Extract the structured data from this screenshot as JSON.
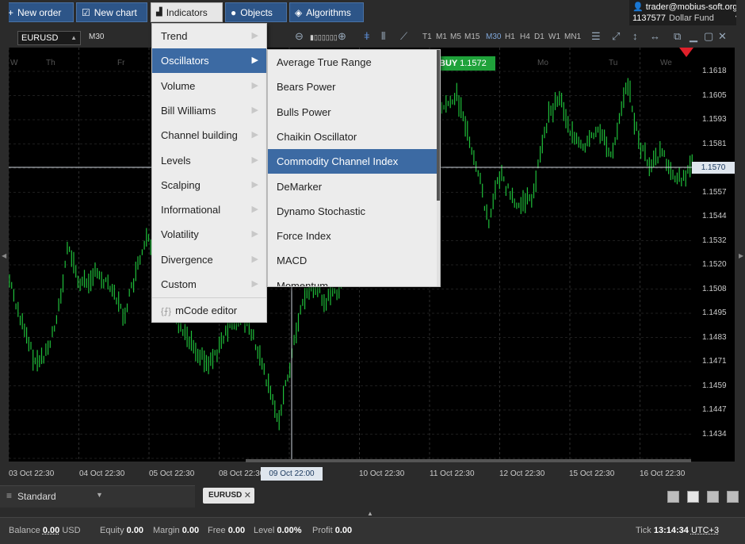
{
  "toolbar": {
    "new_order": "New order",
    "new_chart": "New chart",
    "indicators": "Indicators",
    "objects": "Objects",
    "algorithms": "Algorithms"
  },
  "account": {
    "user": "trader@mobius-soft.org",
    "number": "1137577",
    "fund": "Dollar Fund"
  },
  "chart_toolbar": {
    "symbol": "EURUSD",
    "timeframe": "M30",
    "timeframes": [
      "T1",
      "M1",
      "M5",
      "M15",
      "M30",
      "H1",
      "H4",
      "D1",
      "W1",
      "MN1"
    ],
    "selected_timeframe": "M30"
  },
  "chart": {
    "buy_label": "BUY",
    "buy_price": "1.1572",
    "current_price": "1.1570",
    "crosshair_time": "09 Oct 22:00",
    "price_ticks": [
      "1.1618",
      "1.1605",
      "1.1593",
      "1.1581",
      "1.1557",
      "1.1544",
      "1.1532",
      "1.1520",
      "1.1508",
      "1.1495",
      "1.1483",
      "1.1471",
      "1.1459",
      "1.1447",
      "1.1434"
    ],
    "time_ticks": [
      "03 Oct 22:30",
      "04 Oct 22:30",
      "05 Oct 22:30",
      "08 Oct 22:30",
      "10 Oct 22:30",
      "11 Oct 22:30",
      "12 Oct 22:30",
      "15 Oct 22:30",
      "16 Oct 22:30"
    ],
    "day_labels": [
      "W",
      "Th",
      "Fr",
      "Mo",
      "Tu",
      "We"
    ],
    "candle_color": "#1fbf3a"
  },
  "indicators_menu": {
    "items": [
      {
        "label": "Trend",
        "has_submenu": true
      },
      {
        "label": "Oscillators",
        "has_submenu": true,
        "selected": true
      },
      {
        "label": "Volume",
        "has_submenu": true
      },
      {
        "label": "Bill Williams",
        "has_submenu": true
      },
      {
        "label": "Channel building",
        "has_submenu": true
      },
      {
        "label": "Levels",
        "has_submenu": true
      },
      {
        "label": "Scalping",
        "has_submenu": true
      },
      {
        "label": "Informational",
        "has_submenu": true
      },
      {
        "label": "Volatility",
        "has_submenu": true
      },
      {
        "label": "Divergence",
        "has_submenu": true
      },
      {
        "label": "Custom",
        "has_submenu": true
      }
    ],
    "editor_label": "mCode editor"
  },
  "oscillators_menu": {
    "items": [
      "Average True Range",
      "Bears Power",
      "Bulls Power",
      "Chaikin Oscillator",
      "Commodity Channel Index",
      "DeMarker",
      "Dynamo Stochastic",
      "Force Index",
      "MACD",
      "Momentum"
    ],
    "selected": "Commodity Channel Index"
  },
  "bottom": {
    "layout_name": "Standard",
    "chart_tab": "EURUSD"
  },
  "status": {
    "balance_label": "Balance",
    "balance": "0.00",
    "currency": "USD",
    "equity_label": "Equity",
    "equity": "0.00",
    "margin_label": "Margin",
    "margin": "0.00",
    "free_label": "Free",
    "free": "0.00",
    "level_label": "Level",
    "level": "0.00%",
    "profit_label": "Profit",
    "profit": "0.00",
    "tick_label": "Tick",
    "time": "13:14:34",
    "timezone": "UTC+3"
  }
}
